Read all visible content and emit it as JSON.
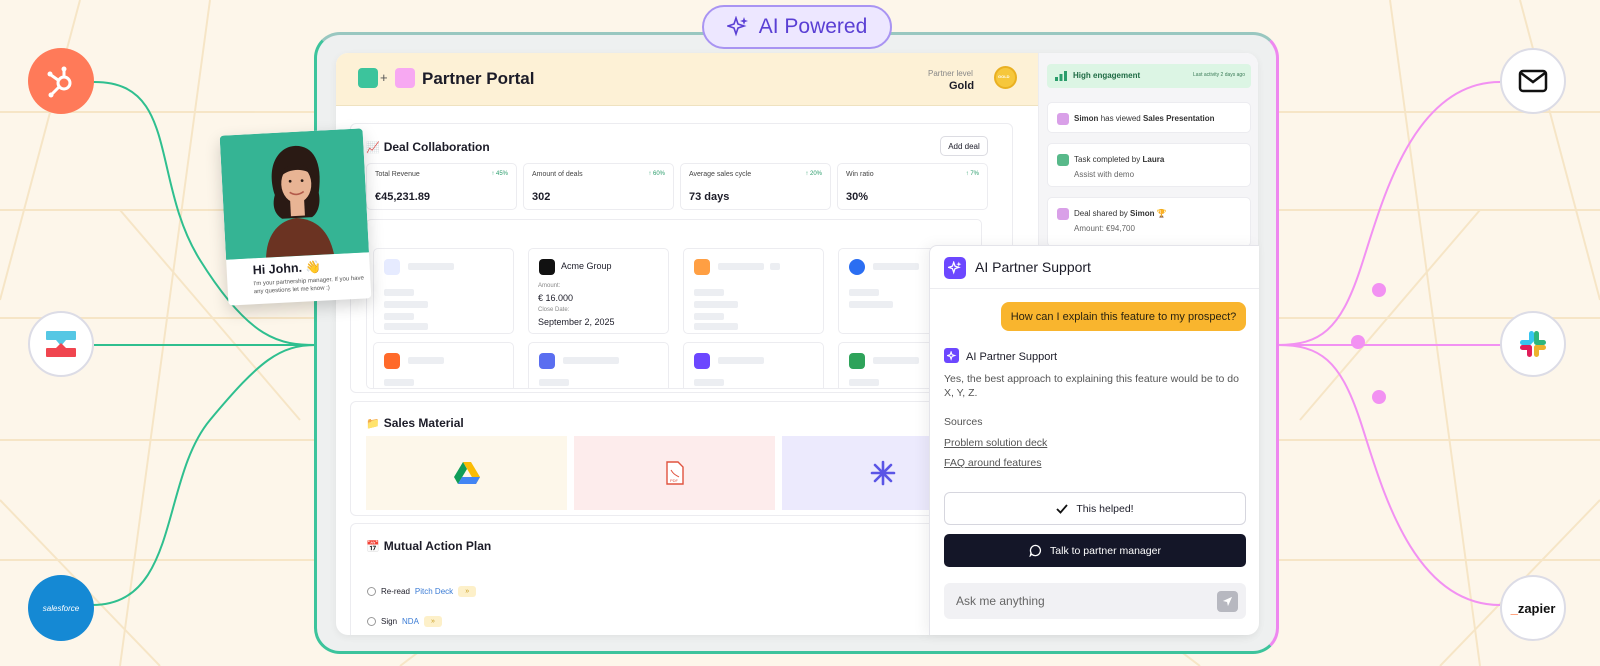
{
  "badge": {
    "label": "AI Powered"
  },
  "integrations": {
    "left": [
      "hubspot-logo",
      "integration-logo",
      "salesforce-logo"
    ],
    "right": [
      "mail-icon",
      "slack-logo",
      "zapier-logo"
    ],
    "salesforce_text": "salesforce",
    "zapier_text": "zapier"
  },
  "portal": {
    "title": "Partner Portal",
    "plus": "+",
    "partner_level_label": "Partner level",
    "partner_level_value": "Gold",
    "medal_text": "GOLD"
  },
  "deals": {
    "title": "Deal Collaboration",
    "add_button": "Add deal",
    "metrics": [
      {
        "label": "Total Revenue",
        "badge": "↑ 45%",
        "value": "€45,231.89"
      },
      {
        "label": "Amount of deals",
        "badge": "↑ 60%",
        "value": "302"
      },
      {
        "label": "Average sales cycle",
        "badge": "↑ 20%",
        "value": "73 days"
      },
      {
        "label": "Win ratio",
        "badge": "↑ 7%",
        "value": "30%"
      }
    ],
    "featured": {
      "company": "Acme Group",
      "amount_label": "Amount:",
      "amount": "€ 16.000",
      "close_label": "Close Date:",
      "close_date": "September 2, 2025"
    }
  },
  "sales_material": {
    "title": "Sales Material",
    "pdf_label": "PDF"
  },
  "mutual_plan": {
    "title": "Mutual Action Plan",
    "items": [
      {
        "prefix": "Re-read",
        "link": "Pitch Deck"
      },
      {
        "prefix": "Sign",
        "link": "NDA"
      }
    ]
  },
  "activity": {
    "engagement": "High engagement",
    "last_activity": "Last activity 2 days ago",
    "items": [
      {
        "name": "Simon",
        "text": "has viewed",
        "target": "Sales Presentation"
      },
      {
        "text": "Task completed by",
        "name": "Laura",
        "sub": "Assist with demo"
      },
      {
        "text": "Deal shared by",
        "name": "Simon",
        "trophy": "🏆",
        "amount": "Amount: €94,700"
      }
    ]
  },
  "chat": {
    "title": "AI Partner Support",
    "user_message": "How can I explain this feature to my prospect?",
    "bot_name": "AI Partner Support",
    "bot_message": "Yes, the best approach to explaining this feature would be to do X, Y, Z.",
    "sources_label": "Sources",
    "sources": [
      "Problem solution deck",
      "FAQ around features"
    ],
    "helped_button": "This helped!",
    "talk_button": "Talk to partner manager",
    "input_placeholder": "Ask me anything"
  },
  "manager_card": {
    "greeting": "Hi John. 👋",
    "message": "I'm your partnership manager. If you have any questions let me know :)"
  },
  "colors": {
    "accent_purple": "#6c47ff",
    "teal": "#3cc49c",
    "pink": "#ee88f0",
    "bubble_orange": "#f9b52e",
    "dark_button": "#141628"
  }
}
